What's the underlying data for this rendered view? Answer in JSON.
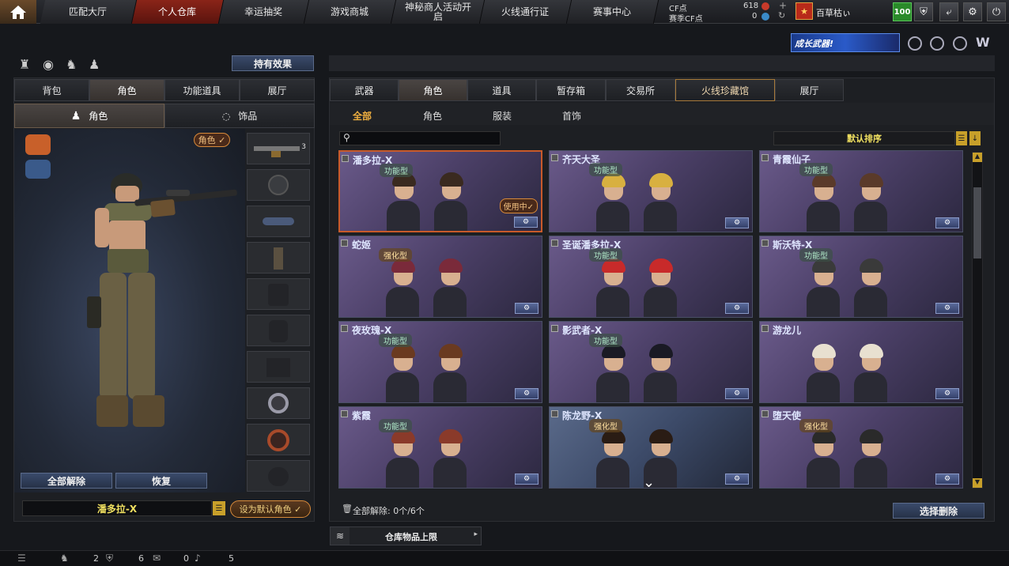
{
  "nav": {
    "tabs": [
      "匹配大厅",
      "个人仓库",
      "幸运抽奖",
      "游戏商城",
      "神秘商人活动开启",
      "火线通行证",
      "赛事中心"
    ],
    "active": "个人仓库",
    "cf_label": "CF点",
    "cf_value": "618",
    "event_cf_label": "赛季CF点",
    "event_cf_value": "0",
    "rank_name": "百草枯ぃ",
    "level": "100",
    "grow_banner": "成长武器!"
  },
  "left": {
    "effects_button": "持有效果",
    "tabs": [
      "背包",
      "角色",
      "功能道具",
      "展厅"
    ],
    "active_tab": "角色",
    "subtabs": [
      "角色",
      "饰品"
    ],
    "active_subtab": "角色",
    "role_tag": "角色 ✓",
    "unequip_all": "全部解除",
    "restore": "恢复",
    "selected_name": "潘多拉-X",
    "set_default": "设为默认角色 ✓",
    "weapon_count": "3"
  },
  "right": {
    "tabs": [
      "武器",
      "角色",
      "道具",
      "暂存箱",
      "交易所",
      "火线珍藏馆",
      "展厅"
    ],
    "active_tab": "角色",
    "subtabs": [
      "全部",
      "角色",
      "服装",
      "首饰"
    ],
    "active_subtab": "全部",
    "search_placeholder": "",
    "sort_label": "默认排序",
    "in_use": "使用中✓",
    "footer_status": "全部解除: 0个/6个",
    "select_delete": "选择删除",
    "storage_limit": "仓库物品上限"
  },
  "cards": [
    {
      "name": "潘多拉-X",
      "badge": "功能型",
      "selected": true
    },
    {
      "name": "齐天大圣",
      "badge": "功能型",
      "selected": false
    },
    {
      "name": "青霞仙子",
      "badge": "功能型",
      "selected": false
    },
    {
      "name": "蛇姬",
      "badge": "强化型",
      "selected": false
    },
    {
      "name": "圣诞潘多拉-X",
      "badge": "功能型",
      "selected": false
    },
    {
      "name": "斯沃特-X",
      "badge": "功能型",
      "selected": false
    },
    {
      "name": "夜玫瑰-X",
      "badge": "功能型",
      "selected": false
    },
    {
      "name": "影武者-X",
      "badge": "功能型",
      "selected": false
    },
    {
      "name": "游龙儿",
      "badge": "",
      "selected": false
    },
    {
      "name": "紫霞",
      "badge": "功能型",
      "selected": false
    },
    {
      "name": "陈龙野-X",
      "badge": "强化型",
      "selected": false
    },
    {
      "name": "堕天使",
      "badge": "强化型",
      "selected": false
    }
  ],
  "bottom": {
    "stat1": "2",
    "stat2": "6",
    "stat3": "0",
    "stat4": "5"
  },
  "colors": {
    "accent": "#c85a2a",
    "panel": "#1d1f23",
    "gold": "#f0c060"
  }
}
